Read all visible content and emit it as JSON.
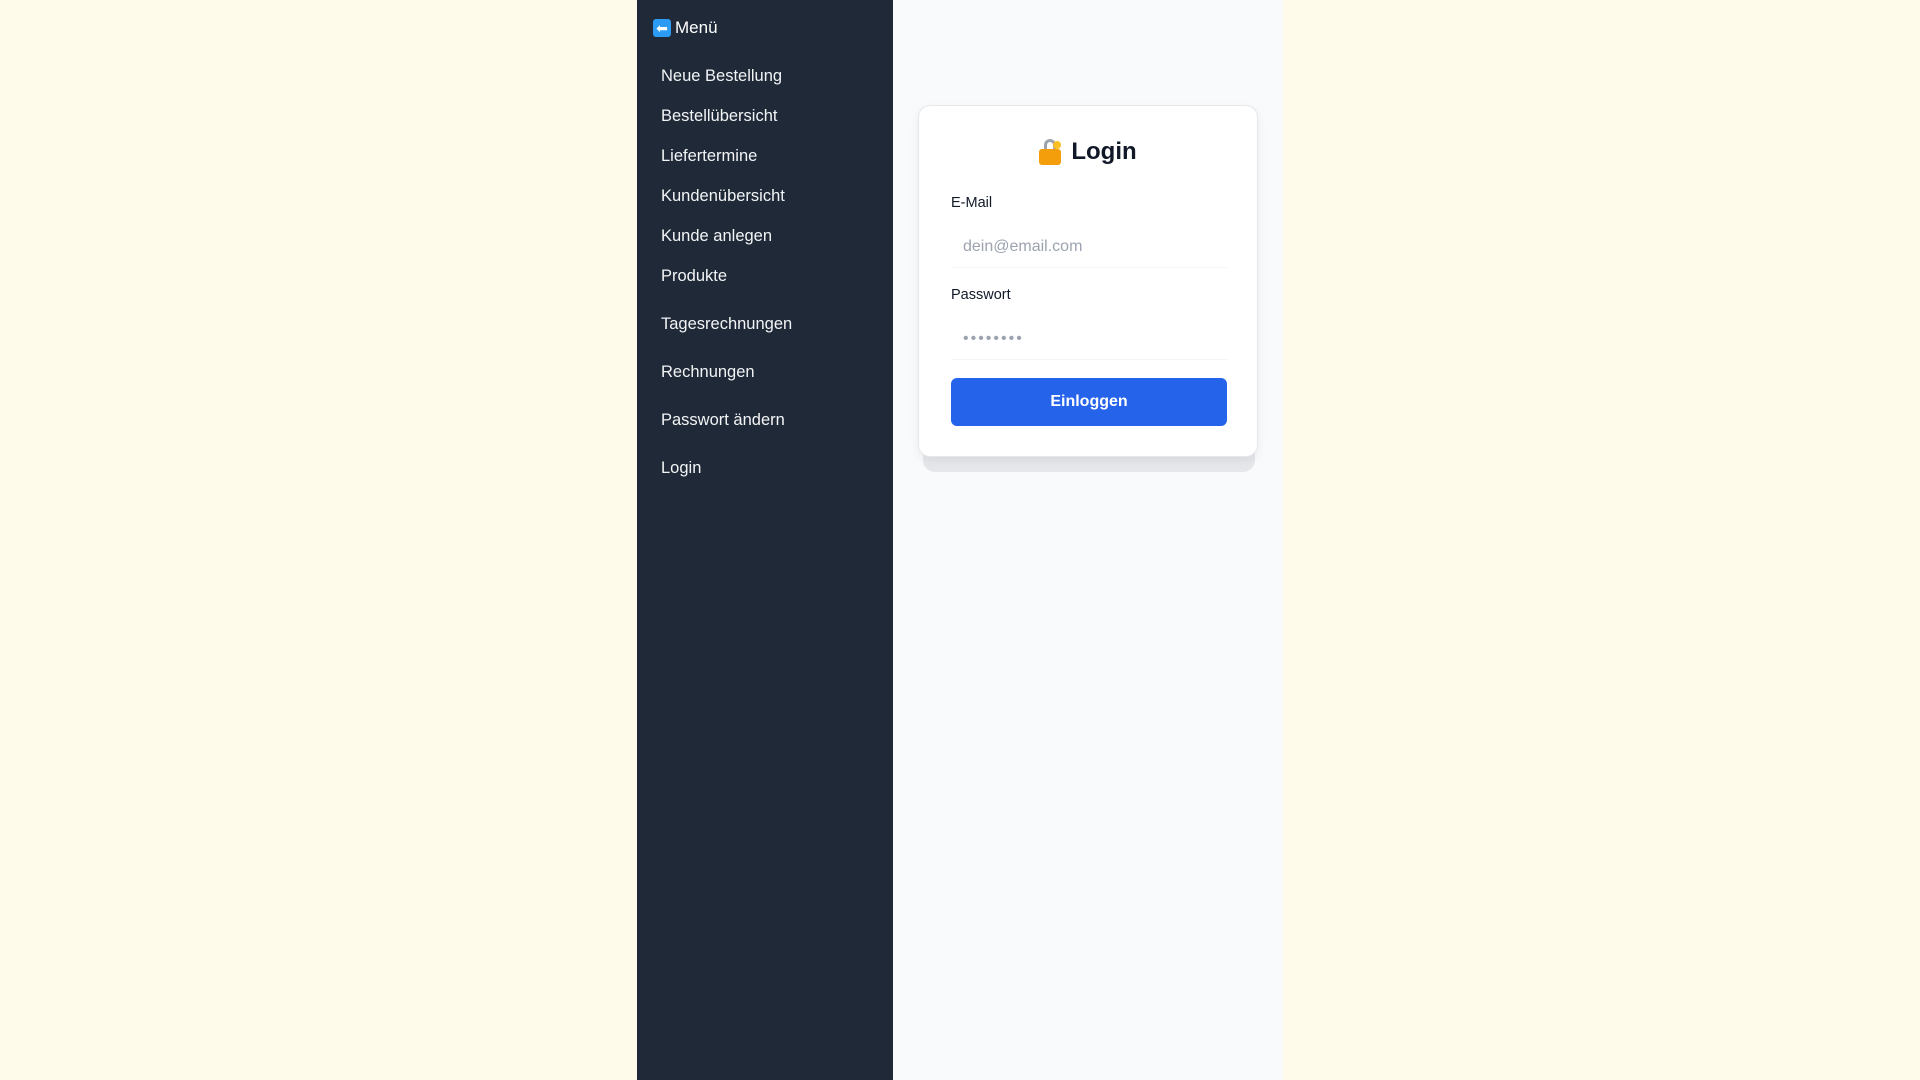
{
  "sidebar": {
    "header": {
      "icon": "back-arrow-icon",
      "label": "Menü"
    },
    "items": [
      {
        "label": "Neue Bestellung"
      },
      {
        "label": "Bestellübersicht"
      },
      {
        "label": "Liefertermine"
      },
      {
        "label": "Kundenübersicht"
      },
      {
        "label": "Kunde anlegen"
      },
      {
        "label": "Produkte"
      },
      {
        "label": "Tagesrechnungen"
      },
      {
        "label": "Rechnungen"
      },
      {
        "label": "Passwort ändern"
      },
      {
        "label": "Login"
      }
    ]
  },
  "login": {
    "title": "Login",
    "title_icon": "lock-with-key-icon",
    "email_label": "E-Mail",
    "email_placeholder": "dein@email.com",
    "password_label": "Passwort",
    "password_placeholder": "••••••••",
    "submit_label": "Einloggen"
  },
  "colors": {
    "page_background": "#fffbeb",
    "sidebar_background": "#1f2937",
    "main_background": "#f9fafb",
    "button": "#2563eb"
  }
}
